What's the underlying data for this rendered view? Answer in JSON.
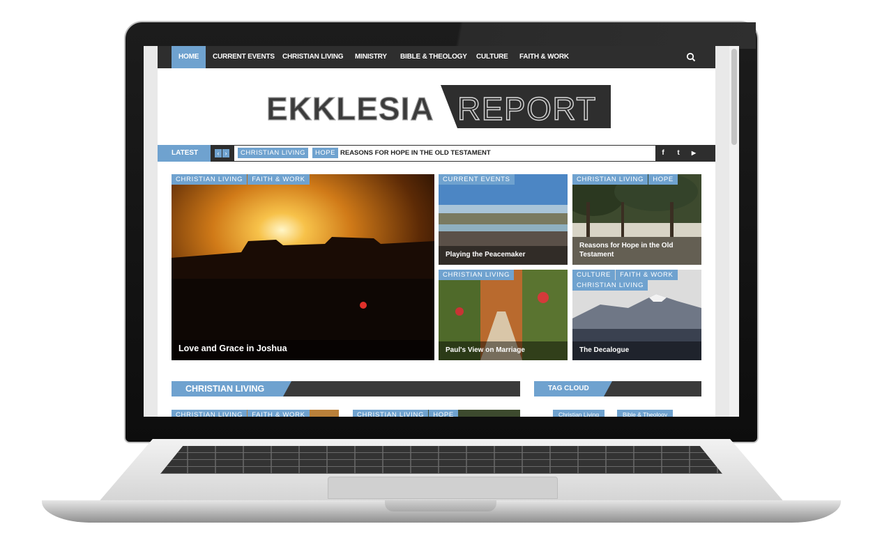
{
  "nav": {
    "items": [
      {
        "label": "HOME",
        "active": true
      },
      {
        "label": "CURRENT EVENTS"
      },
      {
        "label": "CHRISTIAN LIVING"
      },
      {
        "label": "MINISTRY"
      },
      {
        "label": "BIBLE & THEOLOGY"
      },
      {
        "label": "CULTURE"
      },
      {
        "label": "FAITH & WORK"
      }
    ]
  },
  "logo": {
    "left": "EKKLESIA",
    "right": "REPORT"
  },
  "ticker": {
    "label": "LATEST",
    "prev": "‹",
    "next": "›",
    "cat1": "CHRISTIAN LIVING",
    "cat2": "HOPE",
    "headline": "REASONS FOR HOPE IN THE OLD TESTAMENT",
    "social": {
      "facebook": "f",
      "twitter": "t",
      "youtube": "▶"
    }
  },
  "featured": {
    "main": {
      "tags": [
        "CHRISTIAN LIVING",
        "FAITH & WORK"
      ],
      "title": "Love and Grace in Joshua"
    },
    "top_mid": {
      "tags": [
        "CURRENT EVENTS"
      ],
      "title": "Playing the Peacemaker"
    },
    "top_right": {
      "tags": [
        "CHRISTIAN LIVING",
        "HOPE"
      ],
      "title": "Reasons for Hope in the Old Testament"
    },
    "bot_mid": {
      "tags": [
        "CHRISTIAN LIVING"
      ],
      "title": "Paul's View on Marriage"
    },
    "bot_right": {
      "tags": [
        "CULTURE",
        "FAITH & WORK",
        "CHRISTIAN LIVING"
      ],
      "title": "The Decalogue"
    }
  },
  "sections": {
    "christian_living": "CHRISTIAN LIVING",
    "tag_cloud": "TAG CLOUD"
  },
  "peek": {
    "card1_tags": [
      "CHRISTIAN LIVING",
      "FAITH & WORK"
    ],
    "card2_tags": [
      "CHRISTIAN LIVING",
      "HOPE"
    ],
    "cloud": [
      "Christian Living",
      "Bible & Theology"
    ]
  },
  "colors": {
    "accent": "#6fa2cf",
    "dark": "#2e2e2e"
  }
}
